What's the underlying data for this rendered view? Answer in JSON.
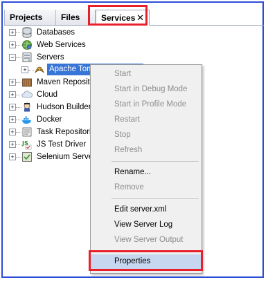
{
  "tabs": {
    "projects": "Projects",
    "files": "Files",
    "services": "Services",
    "close": "✕"
  },
  "tree": [
    {
      "label": "Databases",
      "icon": "database-icon"
    },
    {
      "label": "Web Services",
      "icon": "web-services-icon"
    },
    {
      "label": "Servers",
      "icon": "servers-icon"
    },
    {
      "label": "Apache Tomcat or TomEE",
      "icon": "tomcat-icon",
      "selected": true
    },
    {
      "label": "Maven Repositories",
      "icon": "maven-icon"
    },
    {
      "label": "Cloud",
      "icon": "cloud-icon"
    },
    {
      "label": "Hudson Builders",
      "icon": "hudson-icon"
    },
    {
      "label": "Docker",
      "icon": "docker-icon"
    },
    {
      "label": "Task Repositories",
      "icon": "task-icon"
    },
    {
      "label": "JS Test Driver",
      "icon": "js-icon"
    },
    {
      "label": "Selenium Server",
      "icon": "selenium-icon"
    }
  ],
  "menu": {
    "start": "Start",
    "start_debug": "Start in Debug Mode",
    "start_profile": "Start in Profile Mode",
    "restart": "Restart",
    "stop": "Stop",
    "refresh": "Refresh",
    "rename": "Rename...",
    "remove": "Remove",
    "edit_server_xml": "Edit server.xml",
    "view_server_log": "View Server Log",
    "view_server_output": "View Server Output",
    "properties": "Properties"
  },
  "colors": {
    "frame_border": "#2c4bd6",
    "highlight_red": "#e8202c",
    "selection_blue": "#3875d7"
  }
}
